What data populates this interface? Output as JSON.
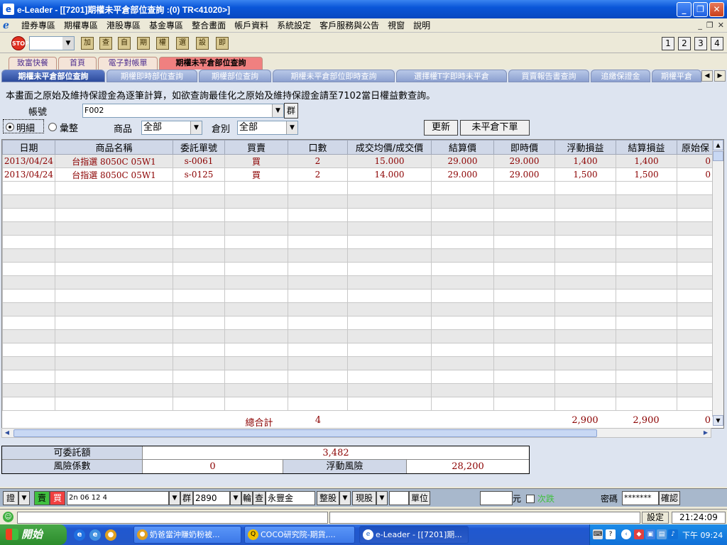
{
  "window": {
    "title": "e-Leader - [[7201]期權未平倉部位查詢 :(0) TR<41020>]",
    "app_icon": "e"
  },
  "menu": [
    "證券專區",
    "期權專區",
    "港股專區",
    "基金專區",
    "整合畫面",
    "帳戶資料",
    "系統設定",
    "客戶服務與公告",
    "視窗",
    "說明"
  ],
  "toolbar": {
    "stop_label": "STOP",
    "icons": [
      "加",
      "查",
      "自",
      "期",
      "權",
      "選",
      "設",
      "即"
    ],
    "nums": [
      "1",
      "2",
      "3",
      "4"
    ]
  },
  "tabs_top": [
    "致富快餐",
    "首頁",
    "電子對帳單",
    "期權未平倉部位查詢"
  ],
  "tabs_sub": [
    "期權未平倉部位查詢",
    "期權即時部位查詢",
    "期權部位查詢",
    "期權未平倉部位即時查詢",
    "選擇權T字即時未平倉",
    "買賣報告書查詢",
    "追繳保證金",
    "期權平倉"
  ],
  "notice": "本畫面之原始及維持保證金為逐筆計算，如欲查詢最佳化之原始及維持保證金請至7102當日權益數查詢。",
  "form": {
    "account_label": "帳號",
    "account_value": "F002",
    "group_btn": "群",
    "radio_detail": "明細",
    "radio_summary": "彙整",
    "product_label": "商品",
    "product_value": "全部",
    "category_label": "倉別",
    "category_value": "全部",
    "refresh_btn": "更新",
    "order_btn": "未平倉下單"
  },
  "table": {
    "columns": [
      "日期",
      "商品名稱",
      "委託單號",
      "買賣",
      "口數",
      "成交均價/成交價",
      "結算價",
      "即時價",
      "浮動損益",
      "結算損益",
      "原始保"
    ],
    "rows": [
      [
        "2013/04/24",
        "台指選 8050C 05W1",
        "s-0061",
        "買",
        "2",
        "15.000",
        "29.000",
        "29.000",
        "1,400",
        "1,400",
        "0"
      ],
      [
        "2013/04/24",
        "台指選 8050C 05W1",
        "s-0125",
        "買",
        "2",
        "14.000",
        "29.000",
        "29.000",
        "1,500",
        "1,500",
        "0"
      ]
    ],
    "total_label": "總合計",
    "total_qty": "4",
    "total_float": "2,900",
    "total_settle": "2,900",
    "total_margin": "0"
  },
  "summary": {
    "available_label": "可委託額",
    "available_value": "3,482",
    "risk_label": "風險係數",
    "risk_value": "0",
    "float_risk_label": "浮動風險",
    "float_risk_value": "28,200"
  },
  "orderbar": {
    "market": "證",
    "buy": "賣",
    "sell": "買",
    "code_input": "2n 06 12 4",
    "group": "群",
    "stock_code": "2890",
    "cycle": "輪",
    "lookup": "查",
    "stock_name": "永豐金",
    "lot_type": "整股",
    "trade_type": "現股",
    "unit": "單位",
    "currency": "元",
    "next_label": "次跌",
    "pwd_label": "密碼",
    "pwd_value": "*******",
    "confirm": "確認"
  },
  "status": {
    "settings": "設定",
    "clock": "21:24:09"
  },
  "taskbar": {
    "start": "開始",
    "tasks": [
      "奶爸當沖賺奶粉被...",
      "COCO研究院-期貨,...",
      "e-Leader - [[7201]期..."
    ],
    "time": "下午 09:24"
  }
}
